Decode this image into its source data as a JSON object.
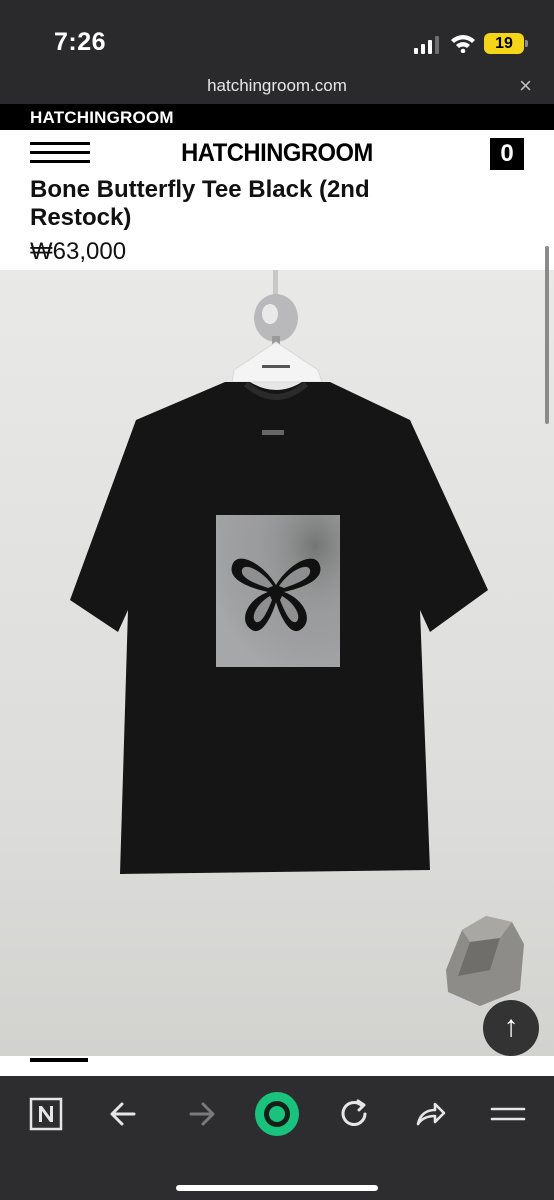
{
  "status_bar": {
    "time": "7:26",
    "battery": "19"
  },
  "browser": {
    "url": "hatchingroom.com",
    "close_glyph": "×"
  },
  "site": {
    "brand_strip": "HATCHINGROOM",
    "logo": "HATCHINGROOM",
    "cart_count": "0"
  },
  "product": {
    "title": "Bone Butterfly Tee Black (2nd Restock)",
    "price": "₩63,000",
    "image": "black-tshirt-butterfly-print"
  },
  "scroll_top_glyph": "↑",
  "toolbar": {
    "icons": [
      "naver-n-icon",
      "back-arrow-icon",
      "forward-arrow-icon",
      "green-circle-home-icon",
      "refresh-icon",
      "share-icon",
      "menu-icon"
    ]
  },
  "colors": {
    "accent_green": "#19c37d",
    "battery_yellow": "#f5d51a"
  }
}
